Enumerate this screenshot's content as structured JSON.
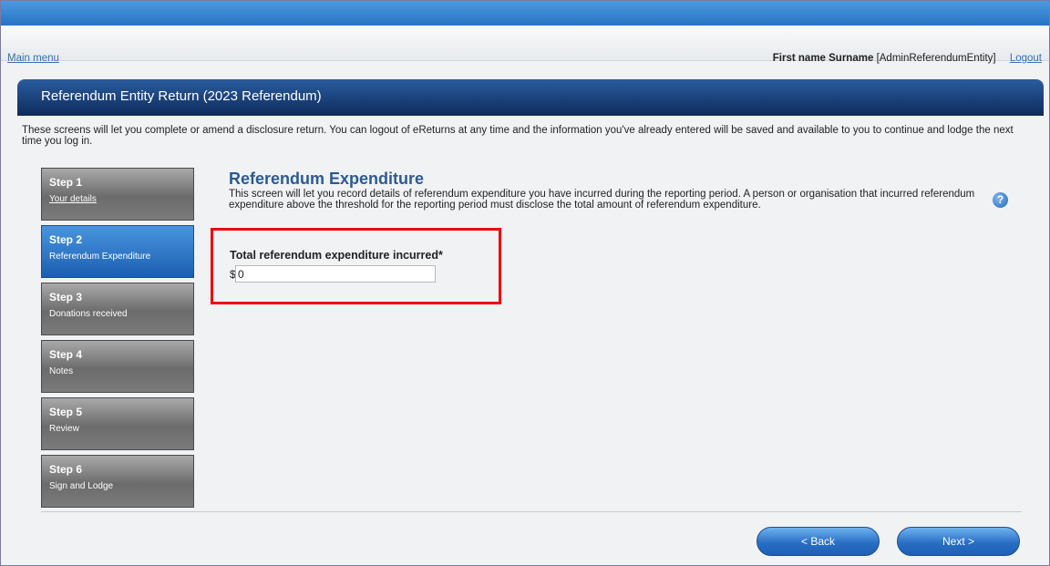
{
  "header": {
    "main_menu_link": "Main menu",
    "user_name": "First name Surname",
    "user_role": "[AdminReferendumEntity]",
    "logout_link": "Logout"
  },
  "panel": {
    "title": "Referendum Entity Return (2023 Referendum)",
    "intro": "These screens will let you complete or amend a disclosure return. You can logout of eReturns at any time and the information you've already entered will be saved and available to you to continue and lodge the next time you log in."
  },
  "steps": [
    {
      "title": "Step 1",
      "subtitle": "Your details",
      "state": "complete"
    },
    {
      "title": "Step 2",
      "subtitle": "Referendum Expenditure",
      "state": "active"
    },
    {
      "title": "Step 3",
      "subtitle": "Donations received",
      "state": "pending"
    },
    {
      "title": "Step 4",
      "subtitle": "Notes",
      "state": "pending"
    },
    {
      "title": "Step 5",
      "subtitle": "Review",
      "state": "pending"
    },
    {
      "title": "Step 6",
      "subtitle": "Sign and Lodge",
      "state": "pending"
    }
  ],
  "content": {
    "heading": "Referendum Expenditure",
    "description": "This screen will let you record details of referendum expenditure you have incurred during the reporting period. A person or organisation that incurred referendum expenditure above the threshold for the reporting period must disclose the total amount of referendum expenditure.",
    "help_icon": "question-mark-icon",
    "field_label": "Total referendum expenditure incurred*",
    "currency_symbol": "$",
    "field_value": "0"
  },
  "buttons": {
    "back": "< Back",
    "next": "Next >"
  },
  "colors": {
    "highlight": "#f00000",
    "header_dark": "#0e2c5c",
    "accent_blue": "#2a6fc4"
  }
}
